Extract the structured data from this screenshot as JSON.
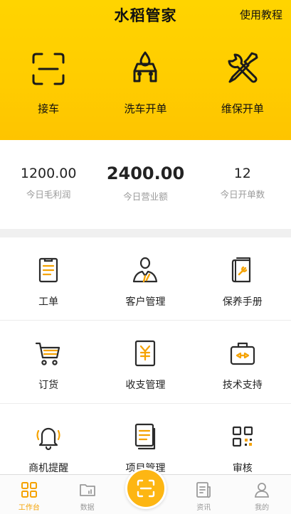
{
  "header": {
    "title": "水稻管家",
    "tutorial_label": "使用教程"
  },
  "quick_actions": [
    {
      "label": "接车",
      "icon": "scan-frame-icon"
    },
    {
      "label": "洗车开单",
      "icon": "car-wash-icon"
    },
    {
      "label": "维保开单",
      "icon": "wrench-screwdriver-icon"
    }
  ],
  "stats": [
    {
      "value": "1200.00",
      "caption": "今日毛利润"
    },
    {
      "value": "2400.00",
      "caption": "今日营业额"
    },
    {
      "value": "12",
      "caption": "今日开单数"
    }
  ],
  "grid": [
    {
      "label": "工单",
      "icon": "work-order-icon"
    },
    {
      "label": "客户管理",
      "icon": "customer-icon"
    },
    {
      "label": "保养手册",
      "icon": "manual-book-icon"
    },
    {
      "label": "订货",
      "icon": "shopping-cart-icon"
    },
    {
      "label": "收支管理",
      "icon": "yen-receipt-icon"
    },
    {
      "label": "技术支持",
      "icon": "toolbox-icon"
    },
    {
      "label": "商机提醒",
      "icon": "bell-icon"
    },
    {
      "label": "项目管理",
      "icon": "project-stack-icon"
    },
    {
      "label": "审核",
      "icon": "qr-code-icon"
    }
  ],
  "tabbar": [
    {
      "label": "工作台",
      "icon": "dashboard-grid-icon",
      "active": true
    },
    {
      "label": "数据",
      "icon": "data-folder-icon",
      "active": false
    },
    {
      "label": "",
      "icon": "scan-icon",
      "active": false
    },
    {
      "label": "资讯",
      "icon": "news-icon",
      "active": false
    },
    {
      "label": "我的",
      "icon": "user-icon",
      "active": false
    }
  ],
  "colors": {
    "brand_yellow": "#ffcd00",
    "accent_orange": "#f5a200",
    "fab_orange": "#fdb613"
  }
}
